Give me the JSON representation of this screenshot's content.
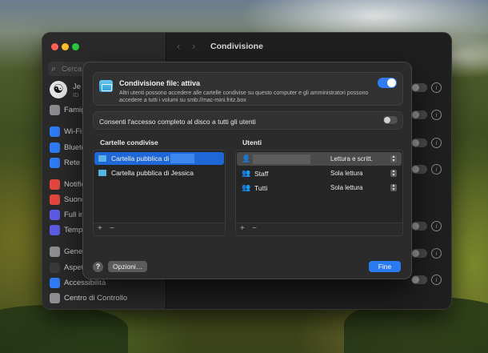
{
  "sidebar": {
    "search_placeholder": "Cerca",
    "account_name": "Je",
    "account_id": "ID",
    "items": [
      {
        "label": "Famig",
        "icon": "family-icon",
        "color": "#8e8e93"
      },
      {
        "label": "Wi-Fi",
        "icon": "wifi-icon",
        "color": "#2f7cf6"
      },
      {
        "label": "Blueto",
        "icon": "bluetooth-icon",
        "color": "#2f7cf6"
      },
      {
        "label": "Rete",
        "icon": "network-icon",
        "color": "#2f7cf6"
      },
      {
        "label": "Notific",
        "icon": "notifications-icon",
        "color": "#e5483f"
      },
      {
        "label": "Suono",
        "icon": "sound-icon",
        "color": "#e5483f"
      },
      {
        "label": "Full in",
        "icon": "focus-icon",
        "color": "#5e5ce6"
      },
      {
        "label": "Tempo",
        "icon": "screen-time-icon",
        "color": "#5e5ce6"
      },
      {
        "label": "Gener",
        "icon": "general-icon",
        "color": "#8e8e93"
      },
      {
        "label": "Aspet",
        "icon": "appearance-icon",
        "color": "#3a3a3a"
      },
      {
        "label": "Accessibilità",
        "icon": "accessibility-icon",
        "color": "#2f7cf6"
      },
      {
        "label": "Centro di Controllo",
        "icon": "control-center-icon",
        "color": "#8e8e93"
      }
    ]
  },
  "main": {
    "title": "Condivisione",
    "nav_back": "‹",
    "nav_forward": "›",
    "info_glyph": "i"
  },
  "dialog": {
    "file_sharing_title": "Condivisione file: attiva",
    "file_sharing_desc": "Altri utenti possono accedere alle cartelle condivise su questo computer e gli amministratori possono accedere a tutti i volumi su smb://mac-mini.fritz.box",
    "file_sharing_enabled": true,
    "full_disk_label": "Consenti l'accesso completo al disco a tutti gli utenti",
    "full_disk_enabled": false,
    "shared_folders_header": "Cartelle condivise",
    "users_header": "Utenti",
    "folders": [
      {
        "label": "Cartella pubblica di",
        "selected": true
      },
      {
        "label": "Cartella pubblica di Jessica",
        "selected": false
      }
    ],
    "users": [
      {
        "name": "",
        "permission": "Lettura e scritt.",
        "icon": "person-icon"
      },
      {
        "name": "Staff",
        "permission": "Sola lettura",
        "icon": "group-icon"
      },
      {
        "name": "Tutti",
        "permission": "Sola lettura",
        "icon": "everyone-icon"
      }
    ],
    "add_label": "+",
    "remove_label": "−",
    "help_label": "?",
    "options_label": "Opzioni…",
    "done_label": "Fine"
  },
  "colors": {
    "accent": "#2f7cf6",
    "selection": "#1f66d6",
    "window_bg": "#1f1f1f",
    "sheet_bg": "#2b2b2b"
  }
}
